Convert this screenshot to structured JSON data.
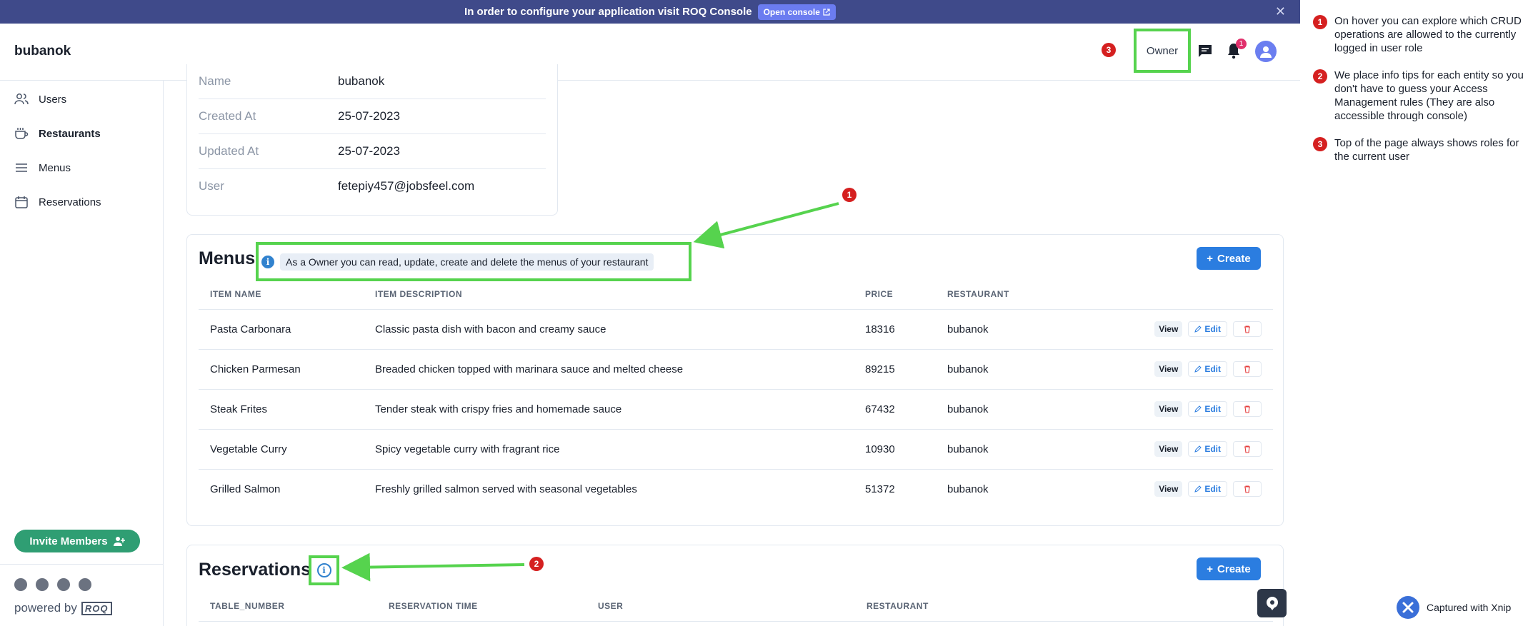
{
  "banner": {
    "text": "In order to configure your application visit ROQ Console",
    "open_console": "Open console",
    "close": "✕"
  },
  "header": {
    "brand": "bubanok",
    "role": "Owner",
    "notification_count": "1",
    "annotation_number": "3"
  },
  "sidebar": {
    "items": [
      {
        "label": "Users",
        "icon": "users-icon"
      },
      {
        "label": "Restaurants",
        "icon": "coffee-icon",
        "active": true
      },
      {
        "label": "Menus",
        "icon": "menu-lines-icon"
      },
      {
        "label": "Reservations",
        "icon": "calendar-icon"
      }
    ],
    "invite_label": "Invite Members",
    "powered_by": "powered by",
    "powered_logo": "ROQ"
  },
  "details": {
    "rows": [
      {
        "key": "Name",
        "value": "bubanok"
      },
      {
        "key": "Created At",
        "value": "25-07-2023"
      },
      {
        "key": "Updated At",
        "value": "25-07-2023"
      },
      {
        "key": "User",
        "value": "fetepiy457@jobsfeel.com"
      }
    ]
  },
  "menus": {
    "title": "Menus",
    "info_tip": "As a Owner you can read, update, create and delete the menus of your restaurant",
    "create_label": "Create",
    "columns": [
      "ITEM NAME",
      "ITEM DESCRIPTION",
      "PRICE",
      "RESTAURANT"
    ],
    "rows": [
      {
        "name": "Pasta Carbonara",
        "description": "Classic pasta dish with bacon and creamy sauce",
        "price": "18316",
        "restaurant": "bubanok"
      },
      {
        "name": "Chicken Parmesan",
        "description": "Breaded chicken topped with marinara sauce and melted cheese",
        "price": "89215",
        "restaurant": "bubanok"
      },
      {
        "name": "Steak Frites",
        "description": "Tender steak with crispy fries and homemade sauce",
        "price": "67432",
        "restaurant": "bubanok"
      },
      {
        "name": "Vegetable Curry",
        "description": "Spicy vegetable curry with fragrant rice",
        "price": "10930",
        "restaurant": "bubanok"
      },
      {
        "name": "Grilled Salmon",
        "description": "Freshly grilled salmon served with seasonal vegetables",
        "price": "51372",
        "restaurant": "bubanok"
      }
    ],
    "view_label": "View",
    "edit_label": "Edit"
  },
  "reservations": {
    "title": "Reservations",
    "create_label": "Create",
    "columns": [
      "TABLE_NUMBER",
      "RESERVATION TIME",
      "USER",
      "RESTAURANT"
    ]
  },
  "annotations": [
    {
      "number": "1",
      "text": "On hover you can explore which CRUD operations are allowed to the currently logged in user role"
    },
    {
      "number": "2",
      "text": "We place info tips for each entity so you don't have to guess your Access Management rules (They are also accessible through console)"
    },
    {
      "number": "3",
      "text": "Top of the page always shows roles for the current user"
    }
  ],
  "xnip": {
    "label": "Captured with Xnip"
  },
  "colors": {
    "banner": "#3f4a8a",
    "highlight": "#56d34e",
    "primary": "#2b7de0",
    "invite": "#2f9e73",
    "badge": "#d52020"
  }
}
